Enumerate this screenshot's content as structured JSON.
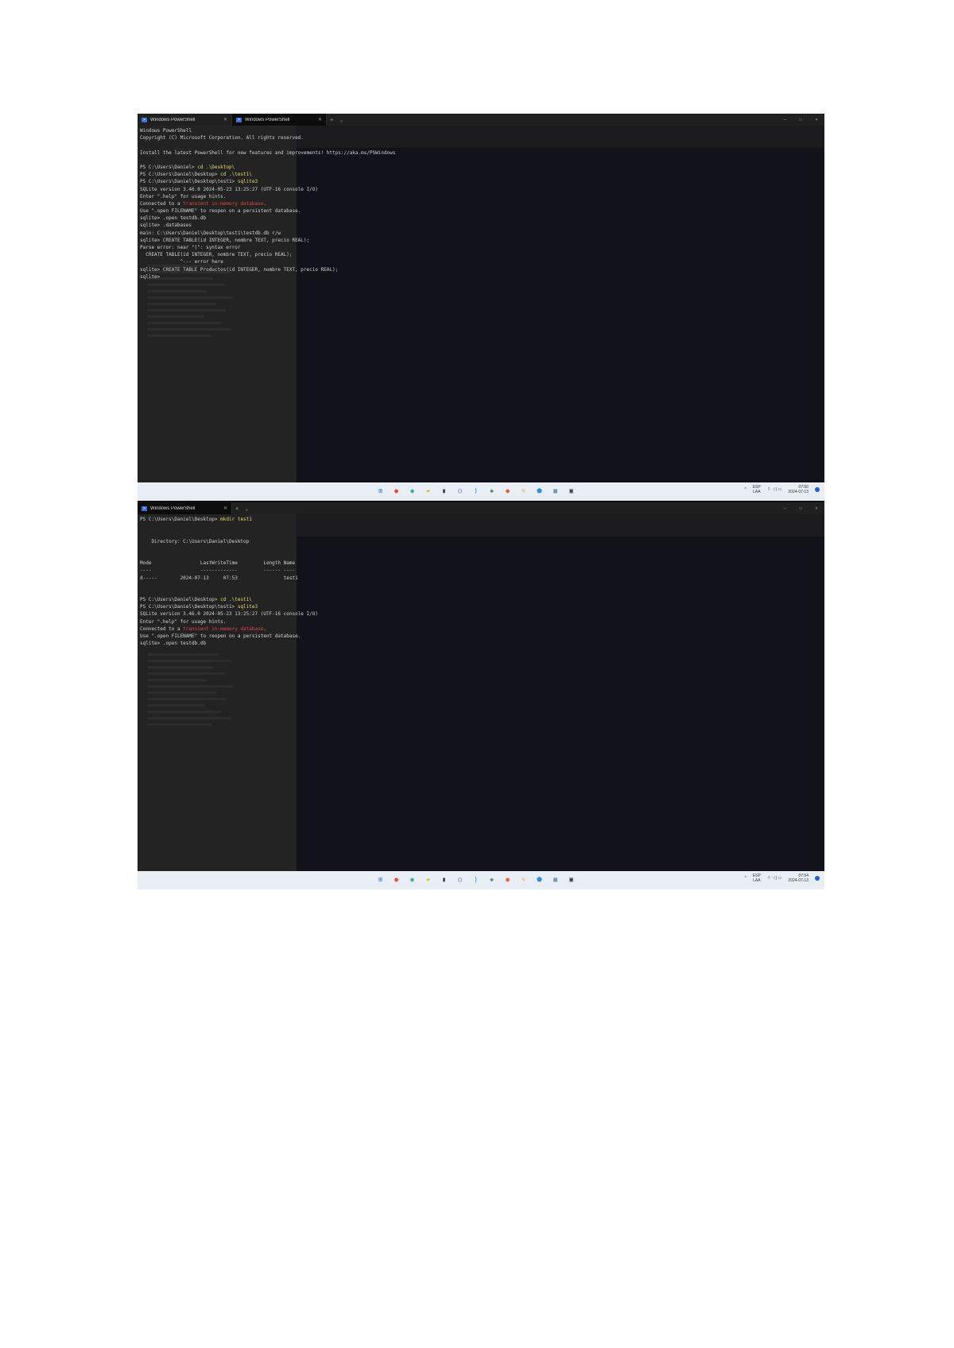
{
  "screenshot1": {
    "tabs": [
      {
        "label": "Windows PowerShell",
        "close": "✕"
      },
      {
        "label": "Windows PowerShell",
        "close": "✕"
      }
    ],
    "console": [
      [
        {
          "t": "Windows PowerShell"
        }
      ],
      [
        {
          "t": "Copyright (C) Microsoft Corporation. All rights reserved."
        }
      ],
      [
        {
          "t": ""
        }
      ],
      [
        {
          "t": "Install the latest PowerShell for new features and improvements! https://aka.ms/PSWindows"
        }
      ],
      [
        {
          "t": ""
        }
      ],
      [
        {
          "t": "PS C:\\Users\\Daniel> "
        },
        {
          "t": "cd .\\Desktop\\",
          "c": "y"
        }
      ],
      [
        {
          "t": "PS C:\\Users\\Daniel\\Desktop> "
        },
        {
          "t": "cd .\\test1\\",
          "c": "y"
        }
      ],
      [
        {
          "t": "PS C:\\Users\\Daniel\\Desktop\\test1> "
        },
        {
          "t": "sqlite3",
          "c": "y"
        }
      ],
      [
        {
          "t": "SQLite version 3.46.0 2024-05-23 13:25:27 (UTF-16 console I/O)"
        }
      ],
      [
        {
          "t": "Enter \".help\" for usage hints."
        }
      ],
      [
        {
          "t": "Connected to a "
        },
        {
          "t": "transient in-memory database",
          "c": "r"
        },
        {
          "t": "."
        }
      ],
      [
        {
          "t": "Use \".open FILENAME\" to reopen on a persistent database."
        }
      ],
      [
        {
          "t": "sqlite> .open testdb.db"
        }
      ],
      [
        {
          "t": "sqlite> .databases"
        }
      ],
      [
        {
          "t": "main: C:\\Users\\Daniel\\Desktop\\test1\\testdb.db r/w"
        }
      ],
      [
        {
          "t": "sqlite> CREATE TABLE(id INTEGER, nombre TEXT, precio REAL);"
        }
      ],
      [
        {
          "t": "Parse error: near \"(\": syntax error"
        }
      ],
      [
        {
          "t": "  CREATE TABLE(id INTEGER, nombre TEXT, precio REAL);"
        }
      ],
      [
        {
          "t": "              ^--- error here"
        }
      ],
      [
        {
          "t": "sqlite> CREATE TABLE Productos(id INTEGER, nombre TEXT, precio REAL);"
        }
      ],
      [
        {
          "t": "sqlite>"
        }
      ]
    ],
    "clock": {
      "time": "07:50",
      "date": "2024-07-13"
    }
  },
  "screenshot2": {
    "tabs": [
      {
        "label": "Windows PowerShell",
        "close": "✕"
      }
    ],
    "console": [
      [
        {
          "t": "PS C:\\Users\\Daniel\\Desktop> "
        },
        {
          "t": "mkdir test1",
          "c": "y"
        }
      ],
      [
        {
          "t": ""
        }
      ],
      [
        {
          "t": ""
        }
      ],
      [
        {
          "t": "    Directory: C:\\Users\\Daniel\\Desktop"
        }
      ],
      [
        {
          "t": ""
        }
      ],
      [
        {
          "t": ""
        }
      ],
      [
        {
          "t": "Mode                 LastWriteTime         Length Name"
        }
      ],
      [
        {
          "t": "----                 -------------         ------ ----"
        }
      ],
      [
        {
          "t": "d-----        2024-07-13     07:53                test1"
        }
      ],
      [
        {
          "t": ""
        }
      ],
      [
        {
          "t": ""
        }
      ],
      [
        {
          "t": "PS C:\\Users\\Daniel\\Desktop> "
        },
        {
          "t": "cd .\\test1\\",
          "c": "y"
        }
      ],
      [
        {
          "t": "PS C:\\Users\\Daniel\\Desktop\\test1> "
        },
        {
          "t": "sqlite3",
          "c": "y"
        }
      ],
      [
        {
          "t": "SQLite version 3.46.0 2024-05-23 13:25:27 (UTF-16 console I/O)"
        }
      ],
      [
        {
          "t": "Enter \".help\" for usage hints."
        }
      ],
      [
        {
          "t": "Connected to a "
        },
        {
          "t": "transient in-memory database",
          "c": "r"
        },
        {
          "t": "."
        }
      ],
      [
        {
          "t": "Use \".open FILENAME\" to reopen on a persistent database."
        }
      ],
      [
        {
          "t": "sqlite> .open testdb.db"
        }
      ]
    ],
    "clock": {
      "time": "07:54",
      "date": "2024-07-13"
    }
  },
  "tab_controls": {
    "new_tab": "+",
    "dropdown": "⌄"
  },
  "window_controls": {
    "minimize": "—",
    "maximize": "☐",
    "close": "✕"
  },
  "taskbar": {
    "icons": [
      {
        "name": "start-icon",
        "glyph": "⊞",
        "color": "#1a73e8"
      },
      {
        "name": "chrome-icon",
        "glyph": "●",
        "color": "#e8453c"
      },
      {
        "name": "edge-icon",
        "glyph": "◉",
        "color": "#1fa37a"
      },
      {
        "name": "file-explorer-icon",
        "glyph": "▰",
        "color": "#e6b422"
      },
      {
        "name": "app-icon",
        "glyph": "▮",
        "color": "#222222"
      },
      {
        "name": "cortana-icon",
        "glyph": "◯",
        "color": "#3b5bdb"
      },
      {
        "name": "vscode-icon",
        "glyph": "⟩",
        "color": "#0e78d4"
      },
      {
        "name": "store-icon",
        "glyph": "◈",
        "color": "#2d7d46"
      },
      {
        "name": "firefox-icon",
        "glyph": "●",
        "color": "#e8612c"
      },
      {
        "name": "paint-icon",
        "glyph": "✎",
        "color": "#e9a13b"
      },
      {
        "name": "defender-icon",
        "glyph": "⬟",
        "color": "#2f8fd8"
      },
      {
        "name": "calculator-icon",
        "glyph": "▦",
        "color": "#5a7fa8"
      },
      {
        "name": "terminal-icon",
        "glyph": "▣",
        "color": "#333333"
      }
    ],
    "language": {
      "line1": "ESP",
      "line2": "LAA"
    },
    "chevron": "^",
    "sys_icons": "⌔ ◁) ▭"
  },
  "colors": {
    "console_bg": "#12131a",
    "prompt_cmd": "#e6dc6e",
    "error_text": "#e04848",
    "taskbar_bg": "#e9eef4"
  }
}
